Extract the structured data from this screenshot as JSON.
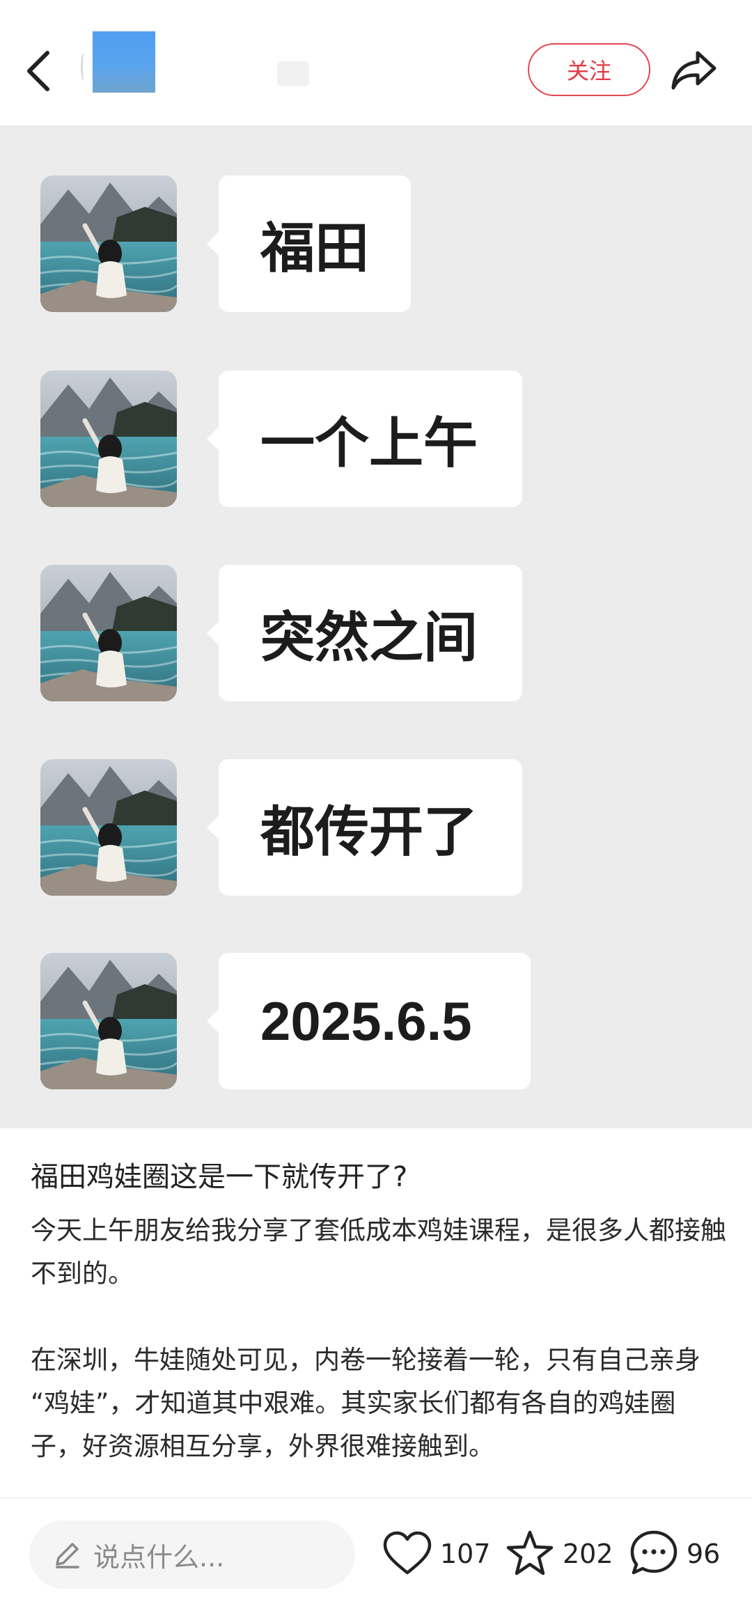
{
  "header": {
    "follow_label": "关注"
  },
  "messages": [
    {
      "text": "福田"
    },
    {
      "text": "一个上午"
    },
    {
      "text": "突然之间"
    },
    {
      "text": "都传开了"
    },
    {
      "text": "2025.6.5"
    }
  ],
  "post": {
    "title": "福田鸡娃圈这是一下就传开了?",
    "paragraphs": [
      "今天上午朋友给我分享了套低成本鸡娃课程，是很多人都接触不到的。",
      "在深圳，牛娃随处可见，内卷一轮接着一轮，只有自己亲身 “鸡娃”，才知道其中艰难。其实家长们都有各自的鸡娃圈子，好资源相互分享，外界很难接触到。"
    ]
  },
  "bottom_bar": {
    "comment_placeholder": "说点什么...",
    "likes": "107",
    "favorites": "202",
    "comments": "96"
  },
  "icons": {
    "back": "chevron-left-icon",
    "share": "share-arrow-icon",
    "like": "heart-icon",
    "favorite": "star-icon",
    "comment": "speech-bubble-icon",
    "pen": "pencil-icon"
  },
  "colors": {
    "accent": "#e03a44",
    "image_bg": "#ececec",
    "bubble_bg": "#ffffff"
  }
}
